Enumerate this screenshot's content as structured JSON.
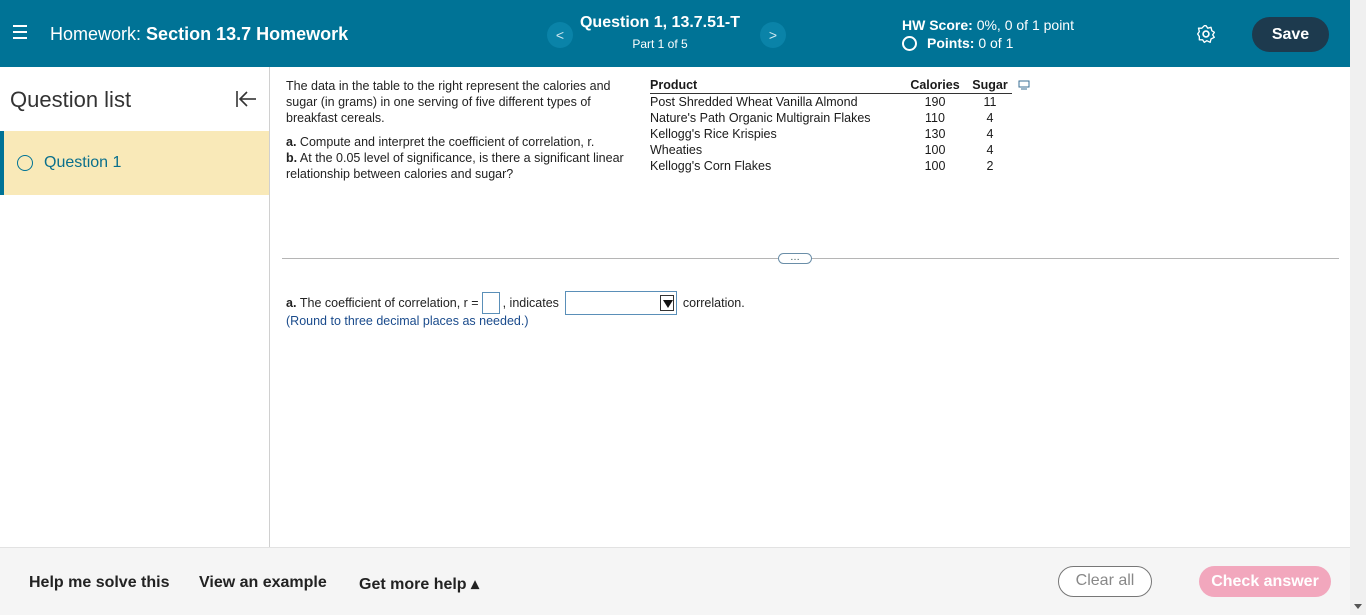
{
  "header": {
    "hw_prefix": "Homework:",
    "hw_name": "Section 13.7 Homework",
    "question_title": "Question 1, 13.7.51-T",
    "part": "Part 1 of 5",
    "prev_label": "<",
    "next_label": ">",
    "hw_score_label": "HW Score:",
    "hw_score_value": "0%, 0 of 1 point",
    "points_label": "Points:",
    "points_value": "0 of 1",
    "save_label": "Save"
  },
  "sidebar": {
    "title": "Question list",
    "items": [
      {
        "label": "Question 1"
      }
    ]
  },
  "problem": {
    "intro": "The data in the table to the right represent the calories and sugar (in grams) in one serving of five different types of breakfast cereals.",
    "part_a_label": "a.",
    "part_a_text": "Compute and interpret the coefficient of correlation, r.",
    "part_b_label": "b.",
    "part_b_text": "At the 0.05 level of significance, is there a significant linear relationship between calories and sugar?"
  },
  "table": {
    "headers": [
      "Product",
      "Calories",
      "Sugar"
    ],
    "rows": [
      [
        "Post Shredded Wheat Vanilla Almond",
        "190",
        "11"
      ],
      [
        "Nature's Path Organic Multigrain Flakes",
        "110",
        "4"
      ],
      [
        "Kellogg's Rice Krispies",
        "130",
        "4"
      ],
      [
        "Wheaties",
        "100",
        "4"
      ],
      [
        "Kellogg's Corn Flakes",
        "100",
        "2"
      ]
    ]
  },
  "answer": {
    "part_label": "a.",
    "prefix": "The coefficient of correlation, r =",
    "middle": ", indicates",
    "suffix": "correlation.",
    "round_note": "(Round to three decimal places as needed.)",
    "more_label": "…"
  },
  "footer": {
    "help_solve": "Help me solve this",
    "view_example": "View an example",
    "more_help": "Get more help ▴",
    "clear_all": "Clear all",
    "check_answer": "Check answer"
  },
  "colors": {
    "header_bg": "#007396",
    "save_bg": "#1d3a4e",
    "selected_question_bg": "#f9e9b8",
    "check_answer_bg": "#f2a7bd"
  },
  "icons": [
    "hamburger-menu-icon",
    "gear-icon",
    "collapse-left-icon",
    "copy-icon",
    "radio-icon",
    "dropdown-arrow-icon"
  ]
}
